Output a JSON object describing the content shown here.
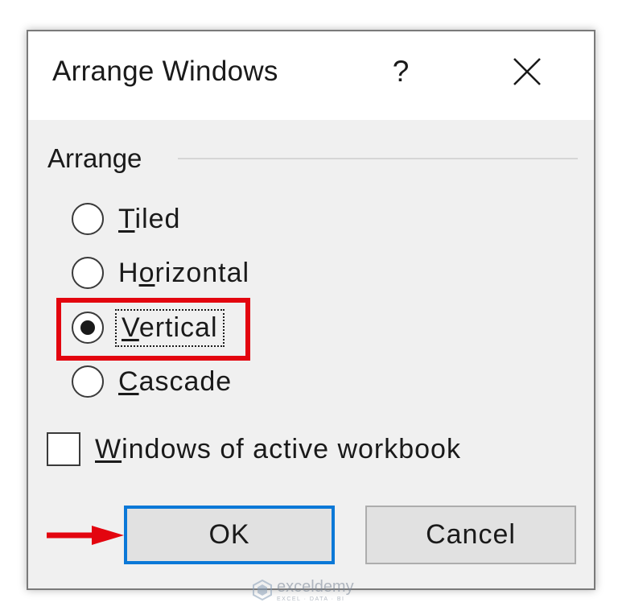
{
  "dialog": {
    "title": "Arrange Windows",
    "help_label": "?"
  },
  "arrange": {
    "group_label": "Arrange",
    "options": [
      {
        "pre": "",
        "key": "T",
        "post": "iled",
        "selected": false
      },
      {
        "pre": "H",
        "key": "o",
        "post": "rizontal",
        "selected": false
      },
      {
        "pre": "",
        "key": "V",
        "post": "ertical",
        "selected": true
      },
      {
        "pre": "",
        "key": "C",
        "post": "ascade",
        "selected": false
      }
    ]
  },
  "active_workbook": {
    "pre": "",
    "key": "W",
    "post": "indows of active workbook",
    "checked": false
  },
  "buttons": {
    "ok": "OK",
    "cancel": "Cancel"
  },
  "annotations": {
    "highlight_color": "#e3050f",
    "arrow_color": "#e3050f"
  },
  "watermark": {
    "name": "exceldemy",
    "tagline": "EXCEL · DATA · BI"
  },
  "colors": {
    "focus_border": "#0b78d7",
    "dialog_bg": "#f0f0f0",
    "title_bg": "#ffffff"
  },
  "icons": {
    "close": "close-icon",
    "arrow": "right-arrow-icon",
    "watermark_logo": "exceldemy-logo-icon"
  }
}
